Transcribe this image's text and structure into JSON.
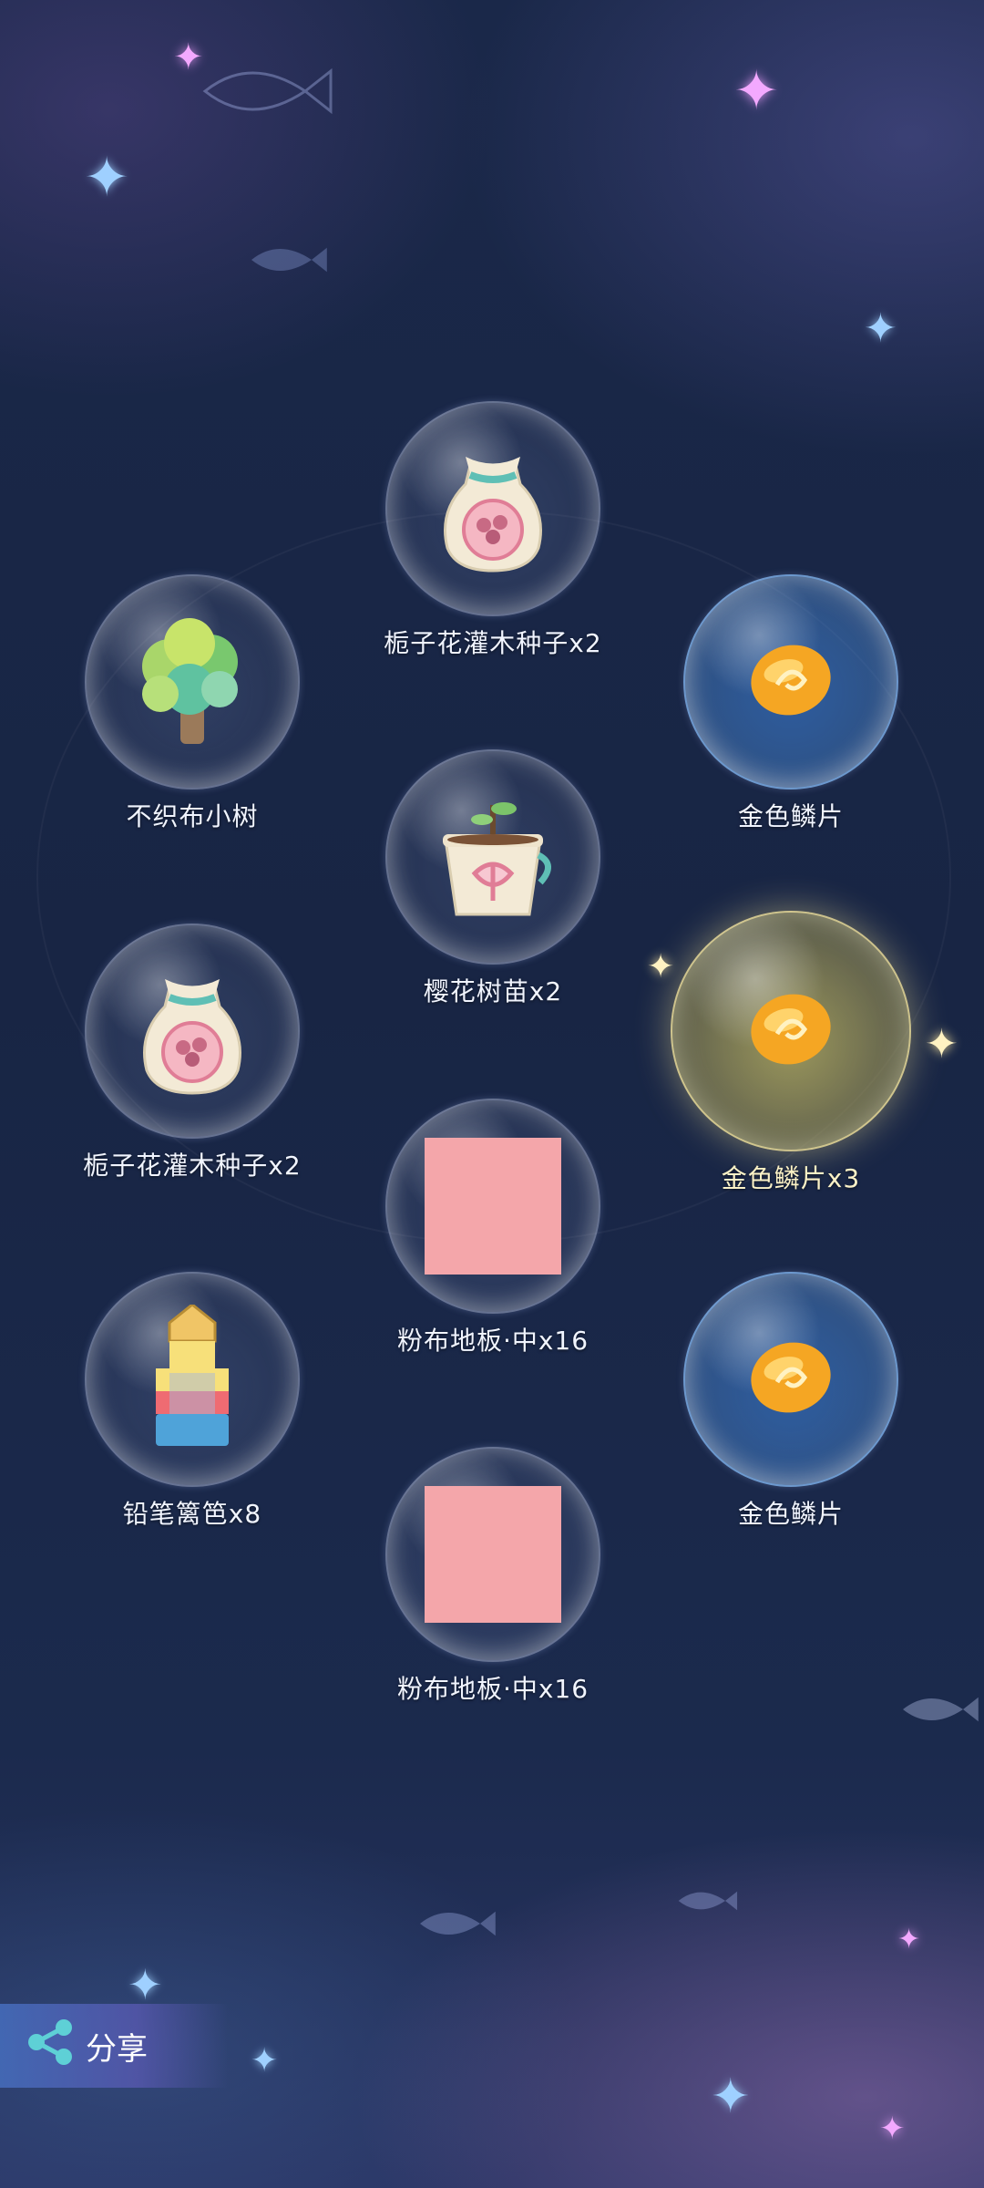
{
  "items": {
    "gardenia_seed_top": {
      "label": "栀子花灌木种子x2",
      "icon": "seed-bag-icon"
    },
    "nonwoven_tree": {
      "label": "不织布小树",
      "icon": "tree-icon"
    },
    "gold_scale_1": {
      "label": "金色鳞片",
      "icon": "gold-scale-icon"
    },
    "sakura_sapling": {
      "label": "樱花树苗x2",
      "icon": "sapling-pot-icon"
    },
    "gardenia_seed_left": {
      "label": "栀子花灌木种子x2",
      "icon": "seed-bag-icon"
    },
    "gold_scale_highlight": {
      "label": "金色鳞片x3",
      "icon": "gold-scale-icon"
    },
    "pink_floor_1": {
      "label": "粉布地板·中x16",
      "icon": "pink-floor-tile"
    },
    "pencil_fence": {
      "label": "铅笔篱笆x8",
      "icon": "pencil-fence-icon"
    },
    "gold_scale_2": {
      "label": "金色鳞片",
      "icon": "gold-scale-icon"
    },
    "pink_floor_2": {
      "label": "粉布地板·中x16",
      "icon": "pink-floor-tile"
    }
  },
  "share": {
    "label": "分享",
    "icon": "share-icon"
  },
  "colors": {
    "pink_tile": "#f4a6aa",
    "gold_scale": "#f5a623",
    "bg": "#1b2a4d"
  }
}
